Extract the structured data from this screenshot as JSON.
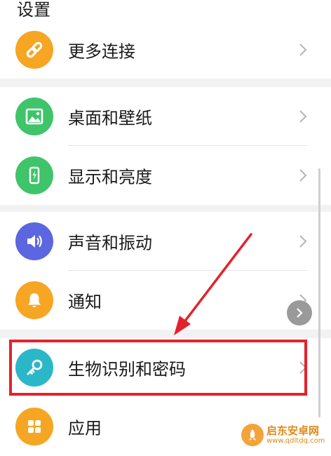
{
  "header": {
    "title": "设置"
  },
  "groups": [
    {
      "items": [
        {
          "label": "更多连接",
          "icon": "link-icon",
          "color": "#f6a623"
        }
      ]
    },
    {
      "items": [
        {
          "label": "桌面和壁纸",
          "icon": "image-icon",
          "color": "#3fc46a"
        },
        {
          "label": "显示和亮度",
          "icon": "phone-brightness-icon",
          "color": "#3fc46a"
        }
      ]
    },
    {
      "items": [
        {
          "label": "声音和振动",
          "icon": "speaker-icon",
          "color": "#5b66e0"
        },
        {
          "label": "通知",
          "icon": "bell-icon",
          "color": "#f6a623"
        }
      ]
    },
    {
      "items": [
        {
          "label": "生物识别和密码",
          "icon": "key-icon",
          "color": "#2ab8c8"
        },
        {
          "label": "应用",
          "icon": "apps-grid-icon",
          "color": "#f6a623"
        }
      ]
    }
  ],
  "annotation": {
    "color": "#e3222b"
  },
  "watermark": {
    "name": "启东安卓网",
    "url": "www.qdltdq.com"
  }
}
